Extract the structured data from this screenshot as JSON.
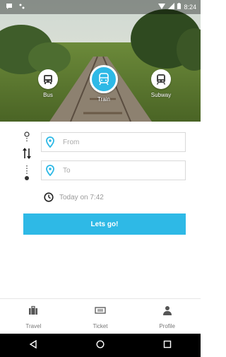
{
  "status_bar": {
    "time": "8:24"
  },
  "transport": [
    {
      "label": "Bus",
      "icon": "bus-icon"
    },
    {
      "label": "Train",
      "icon": "train-icon"
    },
    {
      "label": "Subway",
      "icon": "subway-icon"
    }
  ],
  "form": {
    "from_placeholder": "From",
    "to_placeholder": "To",
    "time_text": "Today on 7:42",
    "go_label": "Lets go!"
  },
  "bottom_nav": [
    {
      "label": "Travel",
      "icon": "suitcase-icon"
    },
    {
      "label": "Ticket",
      "icon": "ticket-icon"
    },
    {
      "label": "Profile",
      "icon": "person-icon"
    }
  ],
  "colors": {
    "accent": "#2eb9e6"
  }
}
